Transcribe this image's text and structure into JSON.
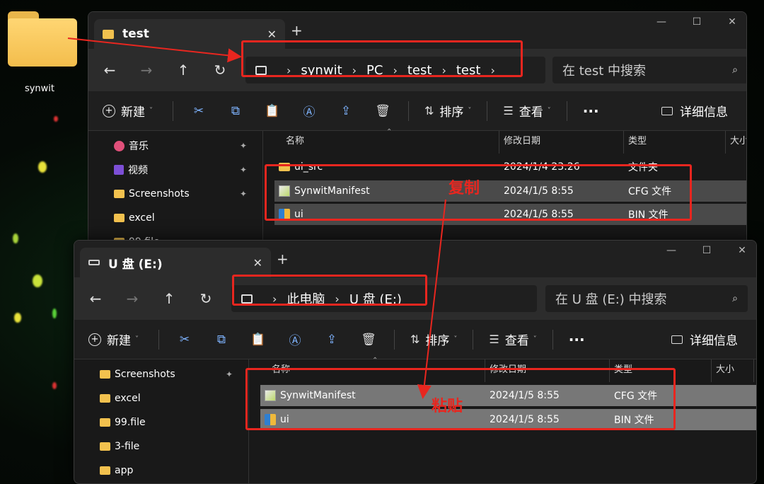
{
  "desktop": {
    "folder_label": "synwit"
  },
  "win1": {
    "tab_title": "test",
    "breadcrumb": [
      "synwit",
      "PC",
      "test",
      "test"
    ],
    "search_placeholder": "在 test 中搜索",
    "toolbar": {
      "new": "新建",
      "sort": "排序",
      "view": "查看",
      "more": "···",
      "details": "详细信息"
    },
    "sidebar": [
      {
        "label": "音乐",
        "icon": "music-icon",
        "pinned": true
      },
      {
        "label": "视频",
        "icon": "video-icon",
        "pinned": true
      },
      {
        "label": "Screenshots",
        "icon": "folder-icon",
        "pinned": true
      },
      {
        "label": "excel",
        "icon": "folder-icon",
        "pinned": false
      },
      {
        "label": "99.file",
        "icon": "folder-icon",
        "pinned": false
      }
    ],
    "columns": {
      "name": "名称",
      "date": "修改日期",
      "type": "类型",
      "size": "大小"
    },
    "files": [
      {
        "name": "ui_src",
        "date": "2024/1/4 23:26",
        "type": "文件夹",
        "icon": "folder"
      },
      {
        "name": "SynwitManifest",
        "date": "2024/1/5 8:55",
        "type": "CFG 文件",
        "icon": "cfg"
      },
      {
        "name": "ui",
        "date": "2024/1/5 8:55",
        "type": "BIN 文件",
        "icon": "bin"
      }
    ]
  },
  "win2": {
    "tab_title": "U 盘 (E:)",
    "breadcrumb": [
      "此电脑",
      "U 盘 (E:)"
    ],
    "search_placeholder": "在 U 盘 (E:) 中搜索",
    "toolbar": {
      "new": "新建",
      "sort": "排序",
      "view": "查看",
      "more": "···",
      "details": "详细信息"
    },
    "sidebar": [
      {
        "label": "Screenshots",
        "icon": "folder-icon",
        "pinned": true
      },
      {
        "label": "excel",
        "icon": "folder-icon",
        "pinned": false
      },
      {
        "label": "99.file",
        "icon": "folder-icon",
        "pinned": false
      },
      {
        "label": "3-file",
        "icon": "folder-icon",
        "pinned": false
      },
      {
        "label": "app",
        "icon": "folder-icon",
        "pinned": false
      }
    ],
    "columns": {
      "name": "名称",
      "date": "修改日期",
      "type": "类型",
      "size": "大小"
    },
    "files": [
      {
        "name": "SynwitManifest",
        "date": "2024/1/5 8:55",
        "type": "CFG 文件",
        "icon": "cfg"
      },
      {
        "name": "ui",
        "date": "2024/1/5 8:55",
        "type": "BIN 文件",
        "icon": "bin"
      }
    ]
  },
  "annotations": {
    "copy": "复制",
    "paste": "粘贴"
  },
  "colors": {
    "annotation_red": "#e8261f",
    "folder_yellow": "#f2c14e",
    "window_bg": "#191919"
  },
  "glyphs": {
    "back": "←",
    "forward": "→",
    "up": "↑",
    "refresh": "↻",
    "chevron": "›",
    "close": "✕",
    "plus": "+",
    "minimize": "—",
    "maximize": "☐",
    "search": "⌕",
    "pin": "✦",
    "sort_caret": "⌃",
    "dropdown": "˅"
  }
}
